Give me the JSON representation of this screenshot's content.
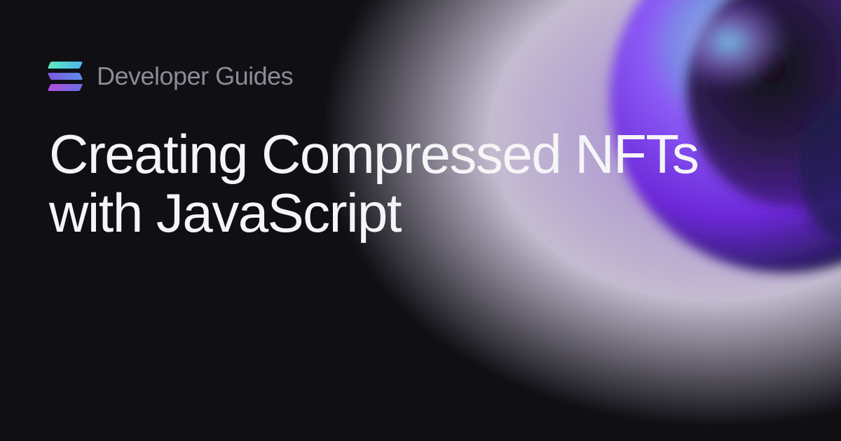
{
  "header": {
    "category": "Developer Guides"
  },
  "title": "Creating Compressed NFTs with JavaScript",
  "brand": {
    "name": "Solana",
    "gradient_colors": [
      "#5de8c1",
      "#4fb5e8",
      "#7c5cdb",
      "#b04fd8"
    ]
  },
  "accent_colors": {
    "purple": "#8b5cf6",
    "teal": "#5de8c1",
    "dark_bg": "#0f0f14"
  }
}
